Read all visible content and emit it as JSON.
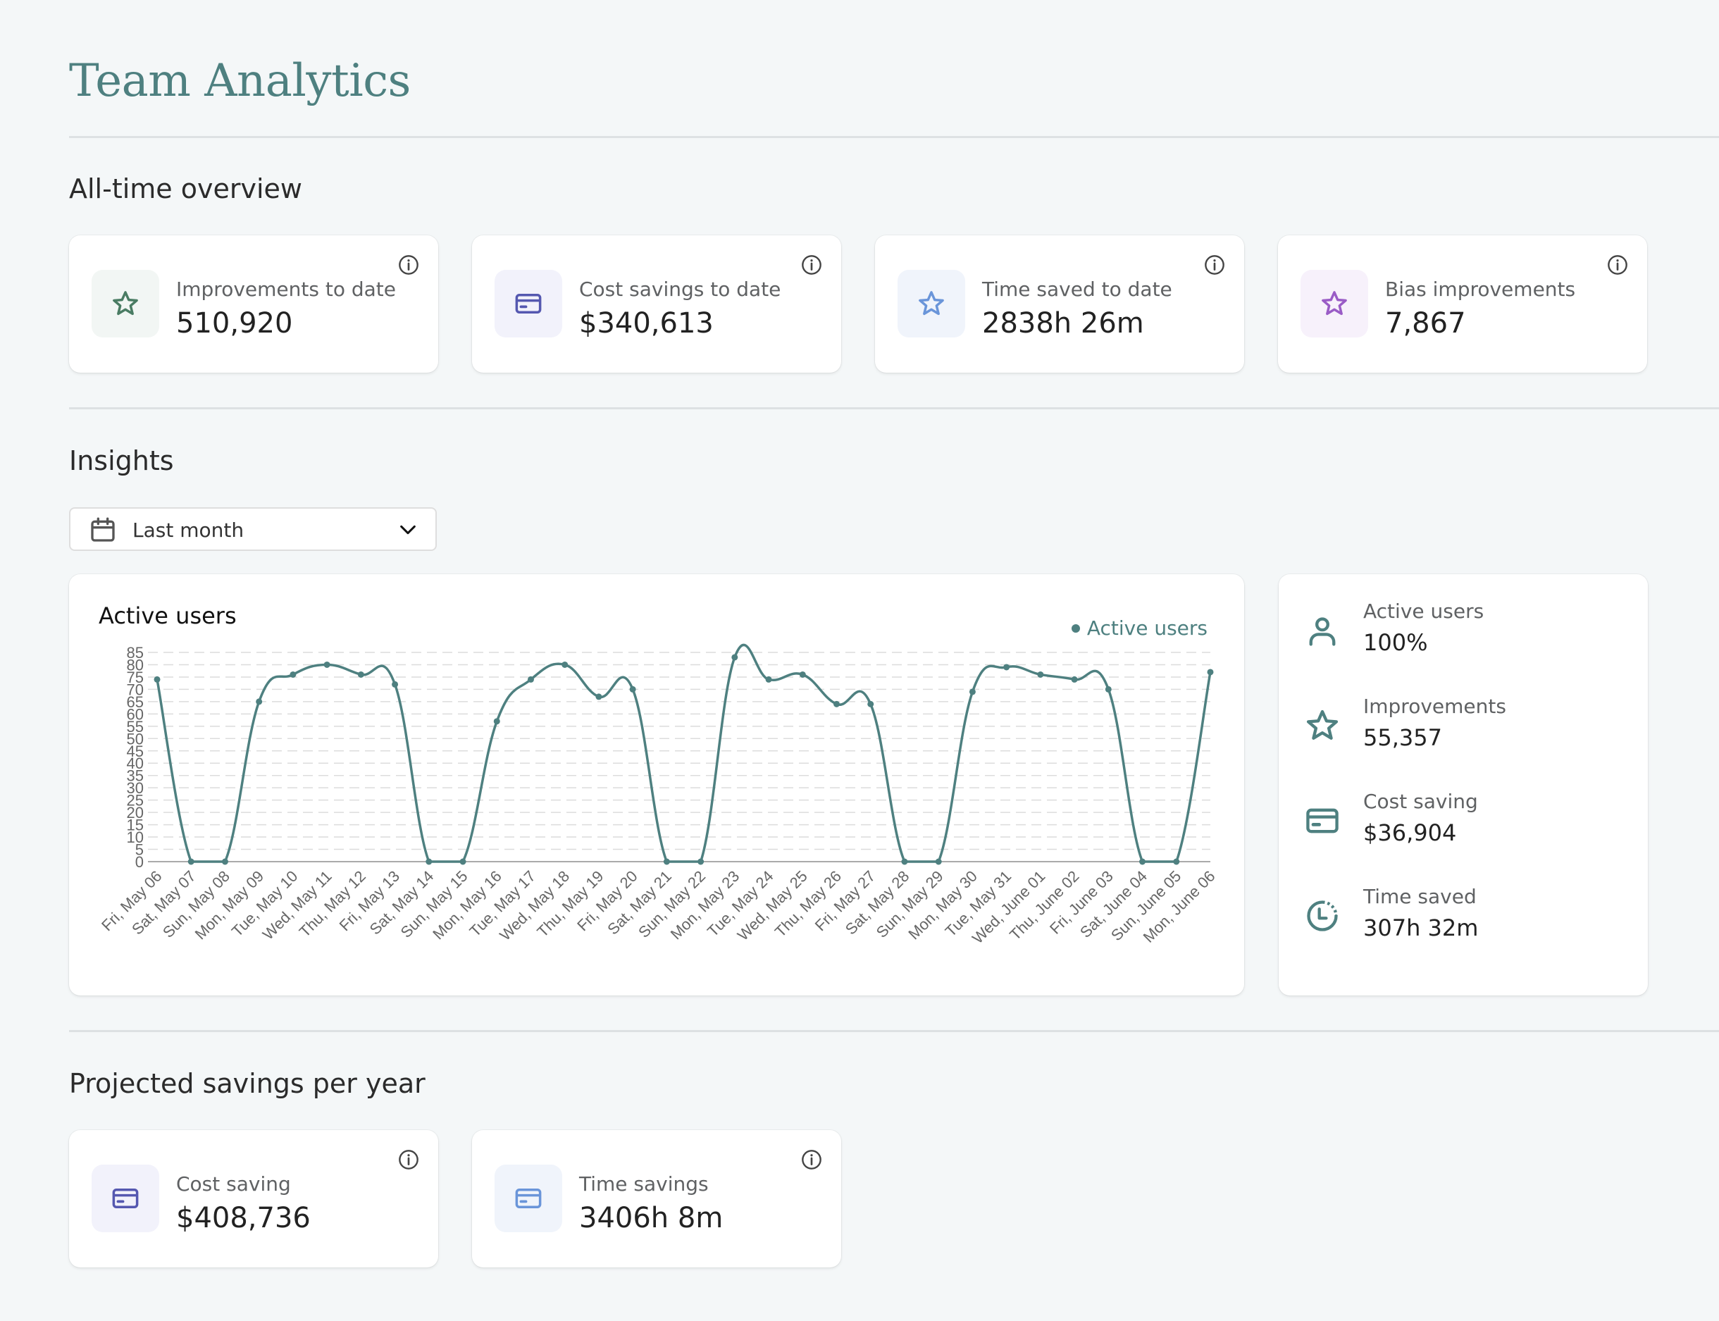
{
  "page": {
    "title": "Team Analytics"
  },
  "colors": {
    "accent": "#4e8080",
    "green": "#4a7c63",
    "indigo": "#5558b0",
    "blue": "#6a95d9",
    "purple": "#9a5cc6"
  },
  "overview": {
    "title": "All-time overview",
    "cards": [
      {
        "label": "Improvements to date",
        "value": "510,920",
        "icon": "star-icon"
      },
      {
        "label": "Cost savings to date",
        "value": "$340,613",
        "icon": "credit-card-icon"
      },
      {
        "label": "Time saved to date",
        "value": "2838h 26m",
        "icon": "star-icon"
      },
      {
        "label": "Bias improvements",
        "value": "7,867",
        "icon": "star-icon"
      }
    ]
  },
  "insights": {
    "title": "Insights",
    "period_select": {
      "value": "Last month",
      "icon": "calendar-icon"
    },
    "summary": [
      {
        "label": "Active users",
        "value": "100%",
        "icon": "user-icon"
      },
      {
        "label": "Improvements",
        "value": "55,357",
        "icon": "star-icon"
      },
      {
        "label": "Cost saving",
        "value": "$36,904",
        "icon": "credit-card-icon"
      },
      {
        "label": "Time saved",
        "value": "307h 32m",
        "icon": "clock-icon"
      }
    ]
  },
  "projected": {
    "title": "Projected savings per year",
    "cards": [
      {
        "label": "Cost saving",
        "value": "$408,736",
        "icon": "credit-card-icon"
      },
      {
        "label": "Time savings",
        "value": "3406h 8m",
        "icon": "credit-card-icon"
      }
    ]
  },
  "chart_data": {
    "type": "line",
    "title": "Active users",
    "legend": [
      "Active users"
    ],
    "legend_position": "top-right",
    "xlabel": "",
    "ylabel": "",
    "ylim": [
      0,
      85
    ],
    "yticks": [
      0,
      5,
      10,
      15,
      20,
      25,
      30,
      35,
      40,
      45,
      50,
      55,
      60,
      65,
      70,
      75,
      80,
      85
    ],
    "grid": true,
    "categories": [
      "Fri, May 06",
      "Sat, May 07",
      "Sun, May 08",
      "Mon, May 09",
      "Tue, May 10",
      "Wed, May 11",
      "Thu, May 12",
      "Fri, May 13",
      "Sat, May 14",
      "Sun, May 15",
      "Mon, May 16",
      "Tue, May 17",
      "Wed, May 18",
      "Thu, May 19",
      "Fri, May 20",
      "Sat, May 21",
      "Sun, May 22",
      "Mon, May 23",
      "Tue, May 24",
      "Wed, May 25",
      "Thu, May 26",
      "Fri, May 27",
      "Sat, May 28",
      "Sun, May 29",
      "Mon, May 30",
      "Tue, May 31",
      "Wed, June 01",
      "Thu, June 02",
      "Fri, June 03",
      "Sat, June 04",
      "Sun, June 05",
      "Mon, June 06"
    ],
    "series": [
      {
        "name": "Active users",
        "values": [
          74,
          0,
          0,
          65,
          76,
          80,
          76,
          72,
          0,
          0,
          57,
          74,
          80,
          67,
          70,
          0,
          0,
          83,
          74,
          76,
          64,
          64,
          0,
          0,
          69,
          79,
          76,
          74,
          70,
          0,
          0,
          77
        ]
      }
    ]
  }
}
